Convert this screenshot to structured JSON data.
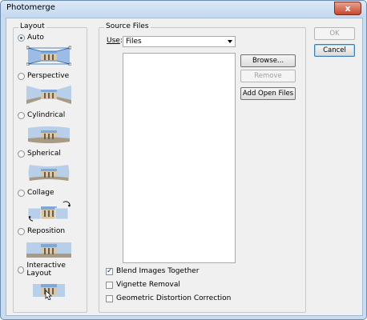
{
  "window": {
    "title": "Photomerge",
    "close_glyph": "x"
  },
  "layout": {
    "legend": "Layout",
    "options": [
      {
        "label": "Auto",
        "selected": true,
        "icon": "auto-layout-icon"
      },
      {
        "label": "Perspective",
        "selected": false,
        "icon": "perspective-layout-icon"
      },
      {
        "label": "Cylindrical",
        "selected": false,
        "icon": "cylindrical-layout-icon"
      },
      {
        "label": "Spherical",
        "selected": false,
        "icon": "spherical-layout-icon"
      },
      {
        "label": "Collage",
        "selected": false,
        "icon": "collage-layout-icon"
      },
      {
        "label": "Reposition",
        "selected": false,
        "icon": "reposition-layout-icon"
      },
      {
        "label": "Interactive Layout",
        "selected": false,
        "icon": "interactive-layout-icon"
      }
    ]
  },
  "source": {
    "legend": "Source Files",
    "use_label": "Use",
    "use_value": "Files",
    "browse": "Browse...",
    "remove": "Remove",
    "add_open": "Add Open Files",
    "file_list": []
  },
  "options": {
    "blend": {
      "label": "Blend Images Together",
      "checked": true
    },
    "vignette": {
      "label": "Vignette Removal",
      "checked": false
    },
    "distortion": {
      "label": "Geometric Distortion Correction",
      "checked": false
    }
  },
  "buttons": {
    "ok": "OK",
    "cancel": "Cancel"
  },
  "colors": {
    "accent": "#3c7fb1",
    "title_bar": "#c4d8ef",
    "close": "#c84630"
  }
}
